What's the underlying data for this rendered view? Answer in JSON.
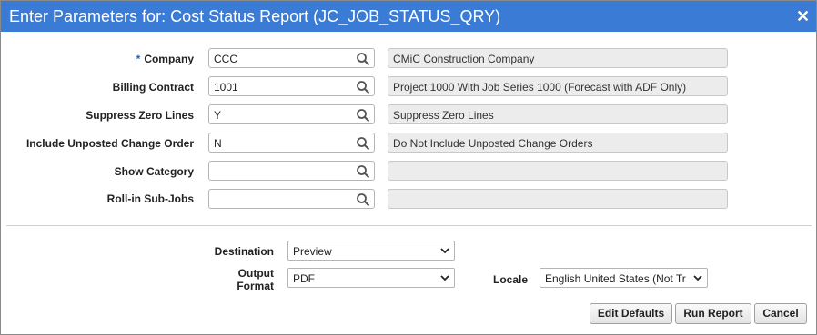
{
  "dialog": {
    "title": "Enter Parameters for: Cost Status Report (JC_JOB_STATUS_QRY)",
    "close_glyph": "✕"
  },
  "params": [
    {
      "required": true,
      "required_mark": "*",
      "label": "Company",
      "value": "CCC",
      "description": "CMiC Construction Company"
    },
    {
      "required": false,
      "label": "Billing Contract",
      "value": "1001",
      "description": "Project 1000 With Job Series 1000 (Forecast with ADF Only)"
    },
    {
      "required": false,
      "label": "Suppress Zero Lines",
      "value": "Y",
      "description": "Suppress Zero Lines"
    },
    {
      "required": false,
      "label": "Include Unposted Change Order",
      "value": "N",
      "description": "Do Not Include Unposted Change Orders"
    },
    {
      "required": false,
      "label": "Show Category",
      "value": "",
      "description": ""
    },
    {
      "required": false,
      "label": "Roll-in Sub-Jobs",
      "value": "",
      "description": ""
    }
  ],
  "output": {
    "destination_label": "Destination",
    "destination_value": "Preview",
    "format_label_line1": "Output",
    "format_label_line2": "Format",
    "format_value": "PDF",
    "locale_label": "Locale",
    "locale_value": "English United States (Not Tr"
  },
  "buttons": {
    "edit_defaults": "Edit Defaults",
    "run_report": "Run Report",
    "cancel": "Cancel"
  },
  "colors": {
    "titlebar": "#3a7bd5",
    "required_mark": "#2b5ea8",
    "description_bg": "#ececec"
  },
  "icons": {
    "lookup": "search-icon",
    "dropdown": "chevron-down-icon",
    "close": "close-icon"
  }
}
